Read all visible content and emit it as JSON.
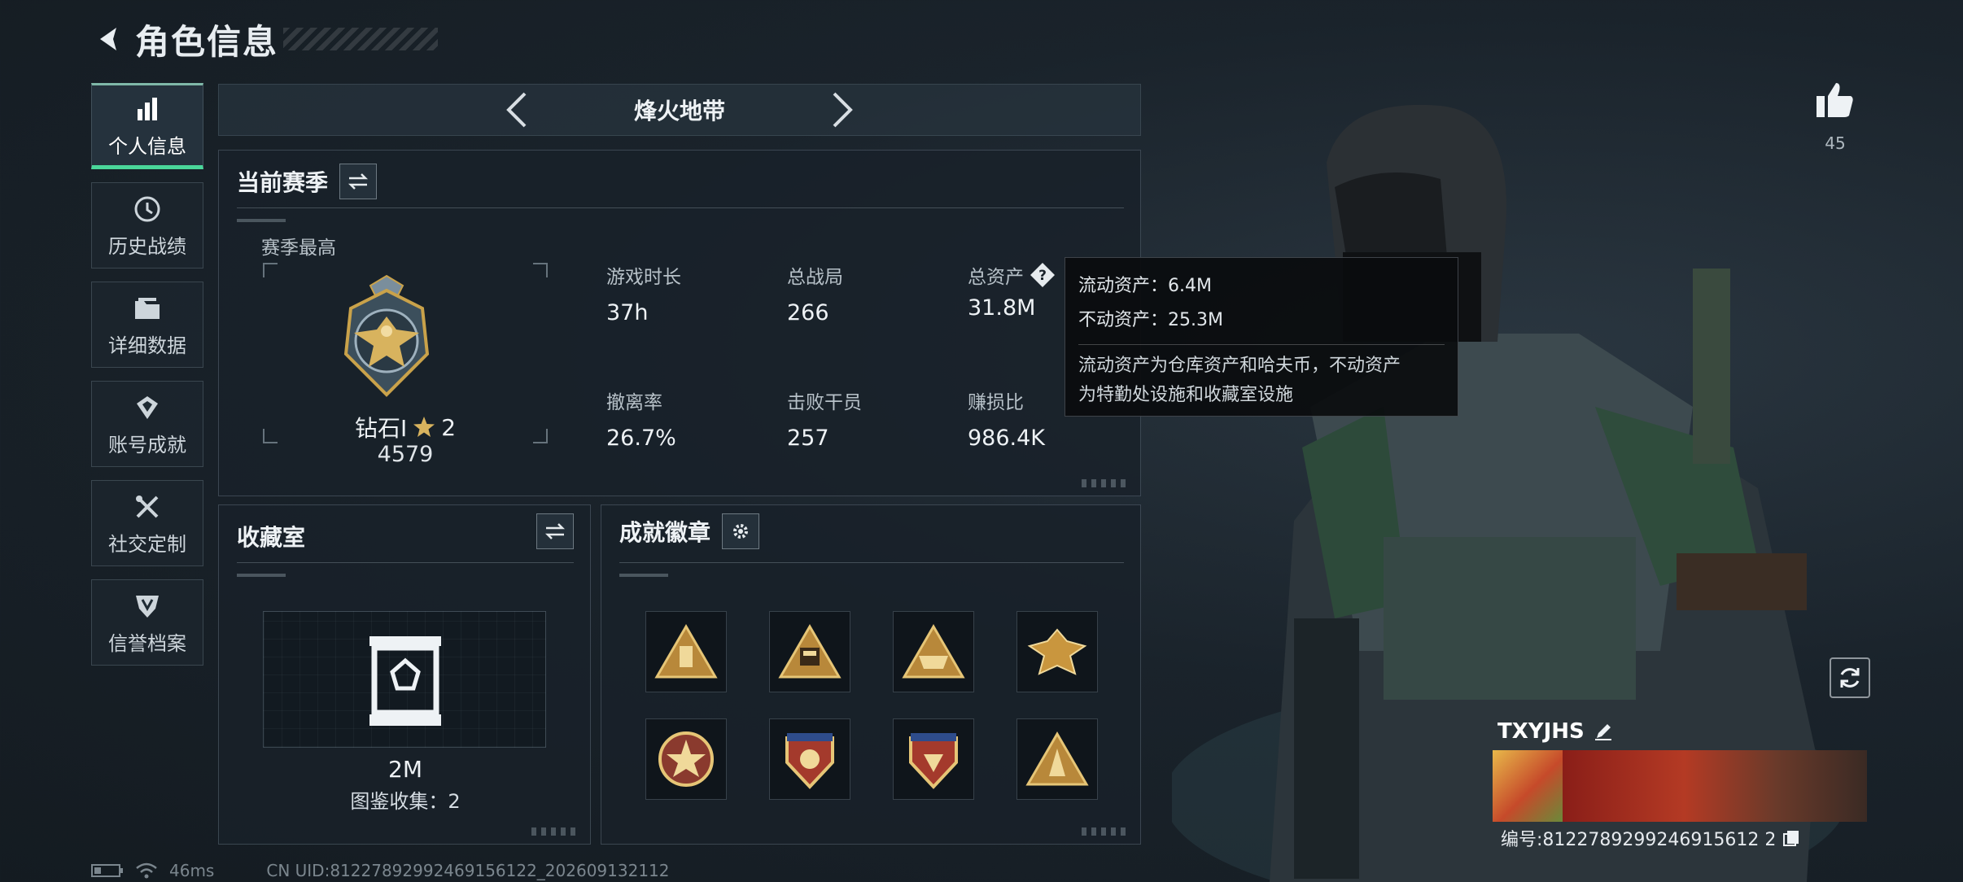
{
  "header": {
    "title": "角色信息"
  },
  "sidebar": {
    "items": [
      {
        "label": "个人信息",
        "icon": "bar-chart-icon",
        "active": true
      },
      {
        "label": "历史战绩",
        "icon": "history-clock-icon"
      },
      {
        "label": "详细数据",
        "icon": "folder-icon"
      },
      {
        "label": "账号成就",
        "icon": "achievement-icon"
      },
      {
        "label": "社交定制",
        "icon": "tools-icon"
      },
      {
        "label": "信誉档案",
        "icon": "shield-icon"
      }
    ]
  },
  "mode": {
    "name": "烽火地带"
  },
  "season": {
    "title": "当前赛季",
    "best_label": "赛季最高",
    "rank_name": "钻石Ⅰ",
    "rank_stars": "2",
    "rank_points": "4579",
    "stats": [
      {
        "label": "游戏时长",
        "value": "37h"
      },
      {
        "label": "总战局",
        "value": "266"
      },
      {
        "label": "总资产",
        "value": "31.8M"
      },
      {
        "label": "撤离率",
        "value": "26.7%"
      },
      {
        "label": "击败干员",
        "value": "257"
      },
      {
        "label": "赚损比",
        "value": "986.4K"
      }
    ]
  },
  "tooltip": {
    "liquid": "流动资产：6.4M",
    "fixed": "不动资产：25.3M",
    "desc_line1": "流动资产为仓库资产和哈夫币，不动资产",
    "desc_line2": "为特勤处设施和收藏室设施"
  },
  "collection": {
    "title": "收藏室",
    "value": "2M",
    "catalog": "图鉴收集：2"
  },
  "badges": {
    "title": "成就徽章",
    "count": 8
  },
  "likes": {
    "count": "45"
  },
  "player": {
    "name": "TXYJHS",
    "id": "编号:8122789299246915612 2"
  },
  "footer": {
    "ping": "46ms",
    "uid": "CN UID:81227892992469156122_202609132112"
  },
  "colors": {
    "accent_green": "#4ad79a",
    "gold": "#c9a24a",
    "panel_bg": "#18212a"
  }
}
